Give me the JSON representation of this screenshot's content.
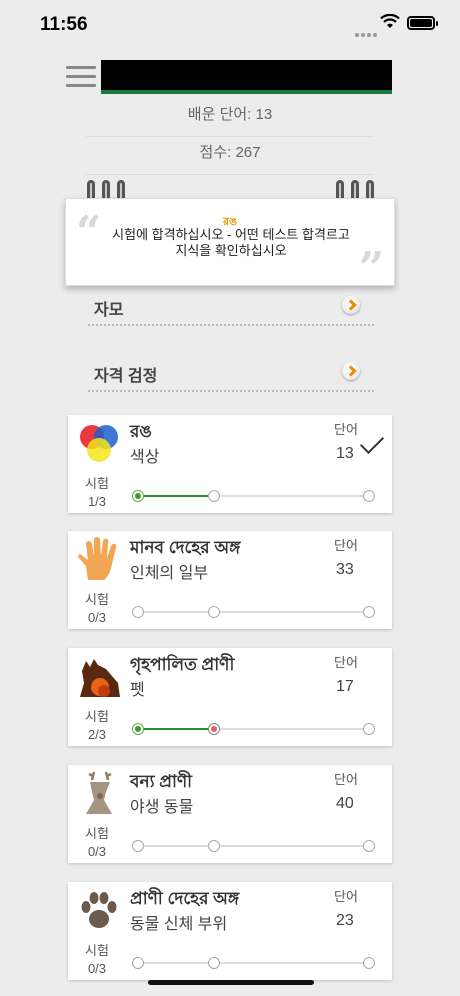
{
  "status": {
    "time": "11:56"
  },
  "stats": {
    "learned_words": "배운 단어: 13",
    "score": "점수: 267"
  },
  "note": {
    "tag": "রঙ",
    "text": "시험에 합격하십시오 - 어떤 테스트 합격르고 지식을 확인하십시오"
  },
  "nav": [
    {
      "label": "자모"
    },
    {
      "label": "자격 검정"
    }
  ],
  "test_label": "시험",
  "word_label": "단어",
  "categories": [
    {
      "title_bn": "রঙ",
      "title_ko": "색상",
      "tests": "1/3",
      "words": "13",
      "progress": 1,
      "completed": true,
      "icon": "color-wheel-icon"
    },
    {
      "title_bn": "মানব দেহের অঙ্গ",
      "title_ko": "인체의 일부",
      "tests": "0/3",
      "words": "33",
      "progress": 0,
      "completed": false,
      "icon": "hand-icon"
    },
    {
      "title_bn": "গৃহপালিত প্রাণী",
      "title_ko": "펫",
      "tests": "2/3",
      "words": "17",
      "progress": 2,
      "completed": false,
      "icon": "pets-icon"
    },
    {
      "title_bn": "বন্য প্রাণী",
      "title_ko": "야생 동물",
      "tests": "0/3",
      "words": "40",
      "progress": 0,
      "completed": false,
      "icon": "deer-icon"
    },
    {
      "title_bn": "প্রাণী দেহের অঙ্গ",
      "title_ko": "동물 신체 부위",
      "tests": "0/3",
      "words": "23",
      "progress": 0,
      "completed": false,
      "icon": "paw-icon"
    }
  ],
  "colors": {
    "accent_orange": "#f08a00",
    "progress_green": "#2e8b2e",
    "banner_green": "#1a7a3c"
  }
}
